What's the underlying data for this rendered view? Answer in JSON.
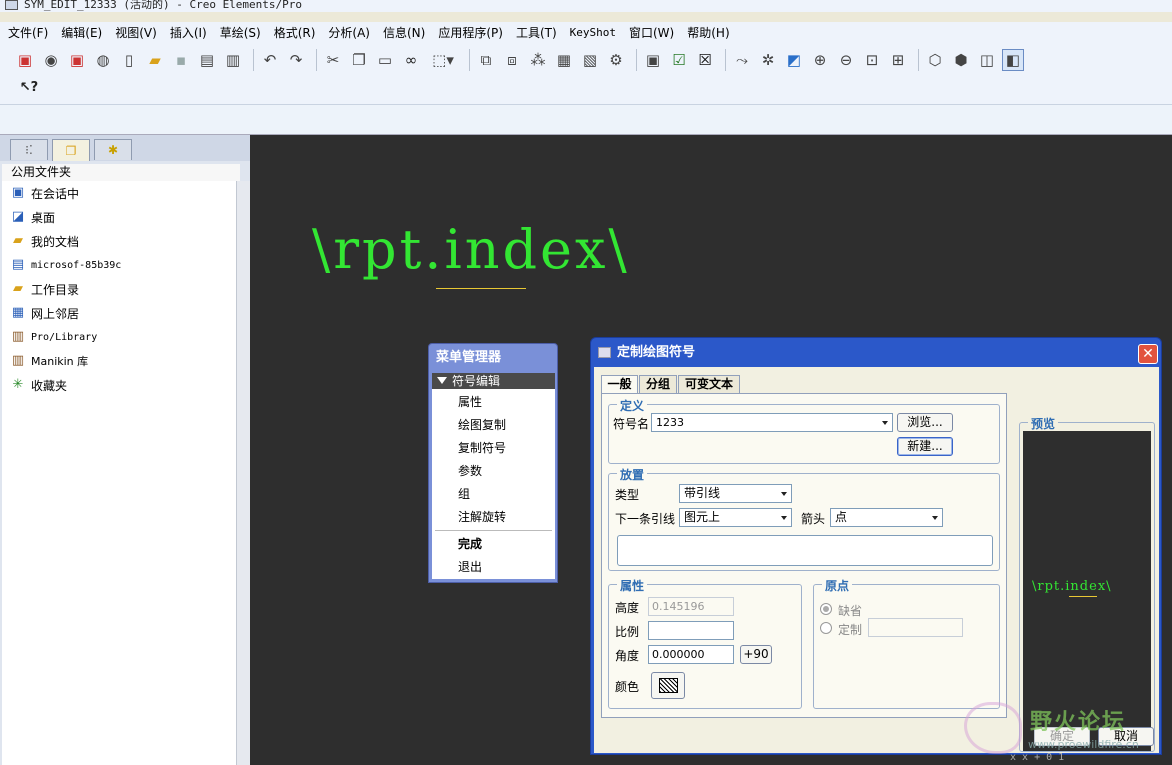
{
  "window": {
    "title": "SYM_EDIT_12333 (活动的) - Creo Elements/Pro"
  },
  "menu": [
    "文件(F)",
    "编辑(E)",
    "视图(V)",
    "插入(I)",
    "草绘(S)",
    "格式(R)",
    "分析(A)",
    "信息(N)",
    "应用程序(P)",
    "工具(T)",
    "KeyShot",
    "窗口(W)",
    "帮助(H)"
  ],
  "toolbar_icons": {
    "row1": [
      "new-drawing-icon",
      "open-icon",
      "save-icon",
      "print-icon",
      "new-file-icon",
      "folder-open-icon",
      "save-disk-icon",
      "save-copy-icon",
      "printer-icon",
      "undo-icon",
      "redo-icon",
      "cut-icon",
      "copy-icon",
      "paste-icon",
      "binoculars-icon",
      "select-box-icon",
      "feature-icon",
      "regenerate-icon",
      "tree-icon",
      "layer-icon",
      "param-icon",
      "relations-icon",
      "window-icon",
      "activate-icon",
      "close-window-icon",
      "sketch-icon",
      "dimension-icon",
      "repaint-icon",
      "zoom-in-icon",
      "zoom-out-icon",
      "refit-icon",
      "orient-icon",
      "wireframe-icon",
      "hidden-line-icon",
      "no-hidden-icon",
      "shading-icon"
    ],
    "row2": [
      "whats-this-icon"
    ]
  },
  "left_pane": {
    "tabs": [
      "model-tree-tab",
      "folder-browser-tab",
      "favorites-tab"
    ],
    "header": "公用文件夹",
    "items": [
      {
        "label": "在会话中",
        "icon": "monitor-icon"
      },
      {
        "label": "桌面",
        "icon": "desktop-icon"
      },
      {
        "label": "我的文档",
        "icon": "my-docs-icon"
      },
      {
        "label": "microsof-85b39c",
        "icon": "computer-icon"
      },
      {
        "label": "工作目录",
        "icon": "work-dir-icon"
      },
      {
        "label": "网上邻居",
        "icon": "network-icon"
      },
      {
        "label": "Pro/Library",
        "icon": "library-icon"
      },
      {
        "label": "Manikin 库",
        "icon": "manikin-icon"
      },
      {
        "label": "收藏夹",
        "icon": "favorites-icon"
      }
    ]
  },
  "canvas": {
    "symbol_text": "\\rpt.index\\"
  },
  "menu_manager": {
    "title": "菜单管理器",
    "submenu": "符号编辑",
    "items": [
      "属性",
      "绘图复制",
      "复制符号",
      "参数",
      "组",
      "注解旋转"
    ],
    "done": "完成",
    "quit": "退出"
  },
  "dialog": {
    "title": "定制绘图符号",
    "tabs": [
      "一般",
      "分组",
      "可变文本"
    ],
    "definition": {
      "group_label": "定义",
      "symbol_name_label": "符号名",
      "symbol_name_value": "1233",
      "browse_button": "浏览...",
      "new_button": "新建..."
    },
    "placement": {
      "group_label": "放置",
      "type_label": "类型",
      "type_value": "带引线",
      "next_leader_label": "下一条引线",
      "next_leader_value": "图元上",
      "arrow_label": "箭头",
      "arrow_value": "点"
    },
    "attributes": {
      "group_label": "属性",
      "height_label": "高度",
      "height_value": "0.145196",
      "scale_label": "比例",
      "scale_value": "",
      "angle_label": "角度",
      "angle_value": "0.000000",
      "plus90_button": "+90",
      "color_label": "颜色"
    },
    "origin": {
      "group_label": "原点",
      "default_label": "缺省",
      "custom_label": "定制",
      "custom_value": ""
    },
    "preview": {
      "group_label": "预览",
      "text": "\\rpt.index\\"
    },
    "ok_button": "确定",
    "cancel_button": "取消"
  },
  "watermark": {
    "text": "野火论坛",
    "url": "www.proewildfire.cn"
  },
  "status_bits": "x x   + 0 1"
}
